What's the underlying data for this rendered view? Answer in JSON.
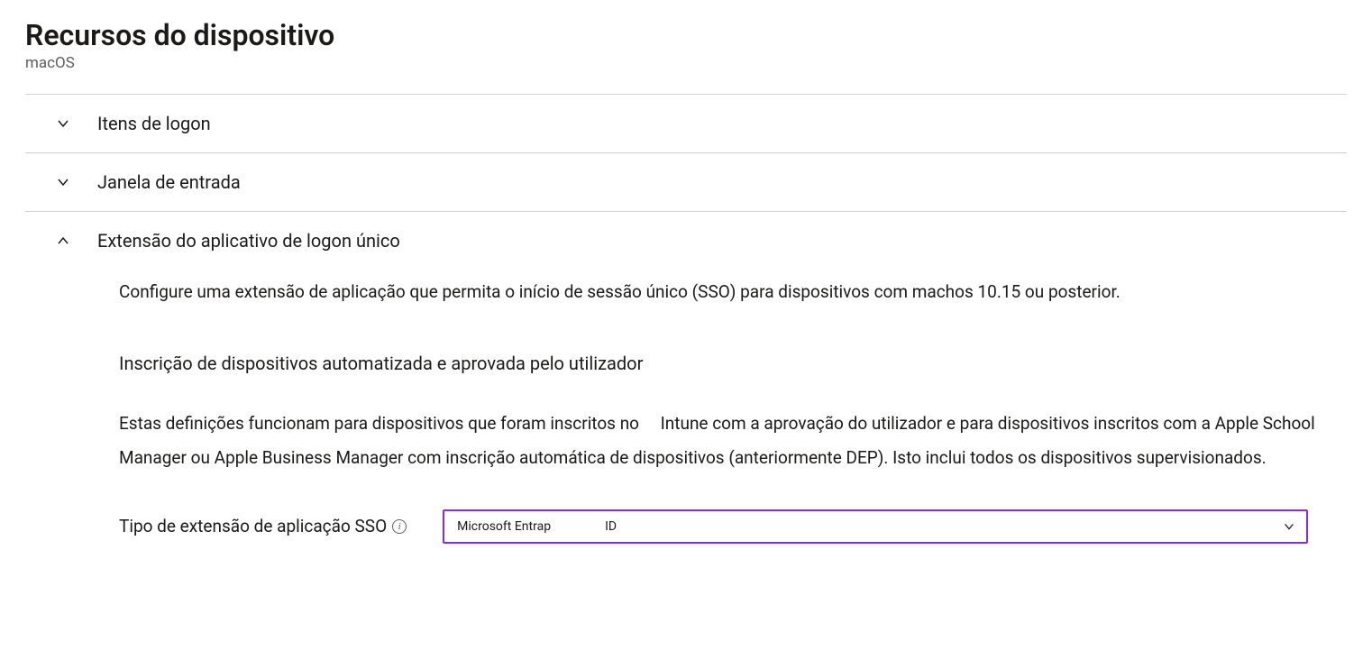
{
  "header": {
    "title": "Recursos do dispositivo",
    "subtitle": "macOS"
  },
  "sections": {
    "login_items": {
      "label": "Itens de logon"
    },
    "login_window": {
      "label": "Janela de entrada"
    },
    "sso_extension": {
      "label": "Extensão do aplicativo de logon único",
      "intro": "Configure uma extensão de aplicação que permita o início de sessão único (SSO) para dispositivos com machos 10.15 ou posterior.",
      "subheading": "Inscrição de dispositivos automatizada e aprovada pelo utilizador",
      "desc": "Estas definições funcionam para dispositivos que foram inscritos no     Intune com a aprovação do utilizador e para dispositivos inscritos com a Apple School Manager ou Apple Business Manager com inscrição automática de dispositivos (anteriormente DEP). Isto inclui todos os dispositivos supervisionados.",
      "field_label": "Tipo de extensão de aplicação SSO",
      "select": {
        "value_part1": "Microsoft Entrap",
        "value_part2": "ID"
      }
    }
  }
}
